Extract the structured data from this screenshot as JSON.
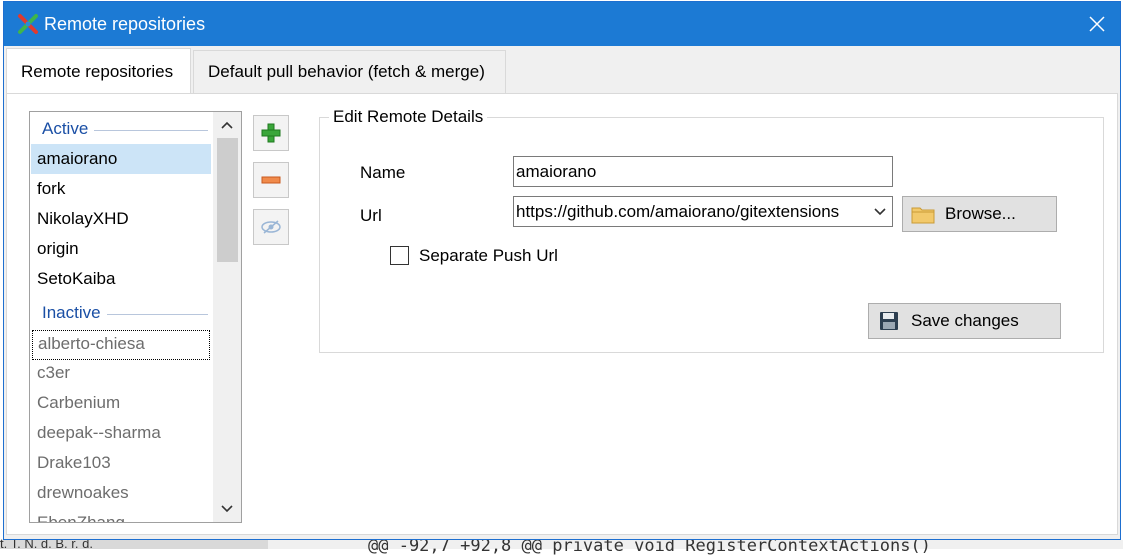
{
  "background": {
    "code_line": "@@ -92,7 +92,8 @@ private void RegisterContextActions()",
    "left_snippet": "t. T. N. d. B. r. d."
  },
  "window": {
    "title": "Remote repositories",
    "close_glyph": "✕",
    "accent": "#1c7ad4"
  },
  "tabs": [
    {
      "label": "Remote repositories",
      "active": true
    },
    {
      "label": "Default pull behavior (fetch & merge)",
      "active": false
    }
  ],
  "remotes": {
    "active_header": "Active",
    "inactive_header": "Inactive",
    "active": [
      "amaiorano",
      "fork",
      "NikolayXHD",
      "origin",
      "SetoKaiba"
    ],
    "inactive": [
      "alberto-chiesa",
      "c3er",
      "Carbenium",
      "deepak--sharma",
      "Drake103",
      "drewnoakes",
      "EbenZhang"
    ],
    "selected": "amaiorano"
  },
  "side_buttons": [
    {
      "icon": "add-icon"
    },
    {
      "icon": "remove-icon"
    },
    {
      "icon": "toggle-visibility-icon"
    }
  ],
  "edit": {
    "group_title": "Edit Remote Details",
    "name_label": "Name",
    "name_value": "amaiorano",
    "url_label": "Url",
    "url_value": "https://github.com/amaiorano/gitextensions",
    "browse_label": "Browse...",
    "separate_push_label": "Separate Push Url",
    "separate_push_checked": false,
    "save_label": "Save changes"
  }
}
